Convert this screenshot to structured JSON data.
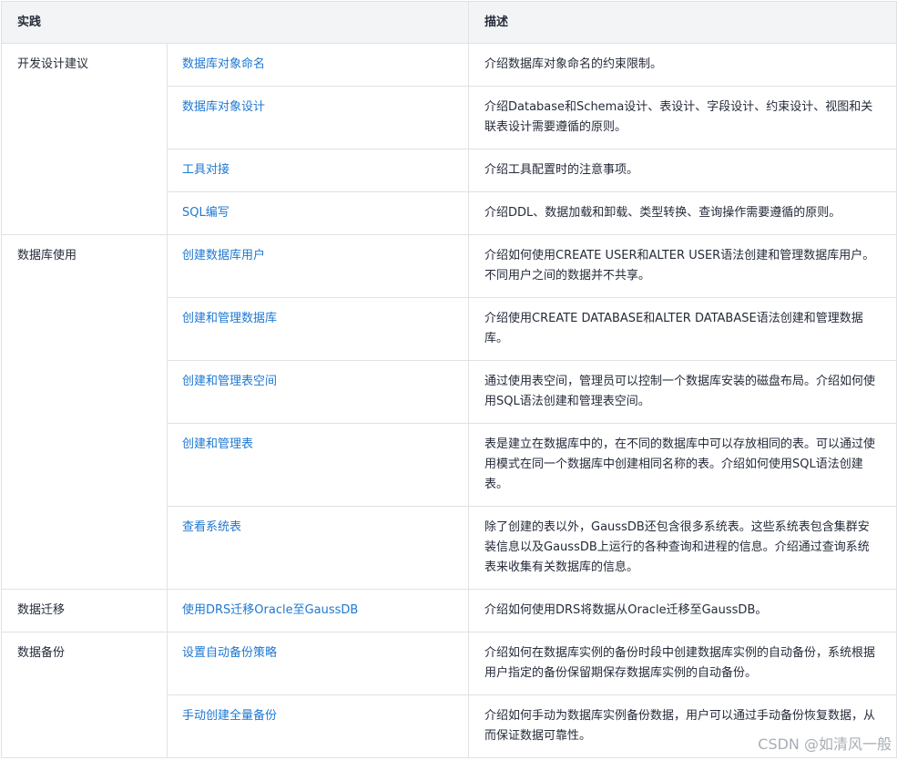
{
  "header": {
    "practice": "实践",
    "description": "描述"
  },
  "groups": [
    {
      "category": "开发设计建议",
      "rows": [
        {
          "link": "数据库对象命名",
          "desc": "介绍数据库对象命名的约束限制。"
        },
        {
          "link": "数据库对象设计",
          "desc": "介绍Database和Schema设计、表设计、字段设计、约束设计、视图和关联表设计需要遵循的原则。"
        },
        {
          "link": "工具对接",
          "desc": "介绍工具配置时的注意事项。"
        },
        {
          "link": "SQL编写",
          "desc": "介绍DDL、数据加载和卸载、类型转换、查询操作需要遵循的原则。"
        }
      ]
    },
    {
      "category": "数据库使用",
      "rows": [
        {
          "link": "创建数据库用户",
          "desc": "介绍如何使用CREATE USER和ALTER USER语法创建和管理数据库用户。不同用户之间的数据并不共享。"
        },
        {
          "link": "创建和管理数据库",
          "desc": "介绍使用CREATE DATABASE和ALTER DATABASE语法创建和管理数据库。"
        },
        {
          "link": "创建和管理表空间",
          "desc": "通过使用表空间，管理员可以控制一个数据库安装的磁盘布局。介绍如何使用SQL语法创建和管理表空间。"
        },
        {
          "link": "创建和管理表",
          "desc": "表是建立在数据库中的，在不同的数据库中可以存放相同的表。可以通过使用模式在同一个数据库中创建相同名称的表。介绍如何使用SQL语法创建表。"
        },
        {
          "link": "查看系统表",
          "desc": "除了创建的表以外，GaussDB还包含很多系统表。这些系统表包含集群安装信息以及GaussDB上运行的各种查询和进程的信息。介绍通过查询系统表来收集有关数据库的信息。"
        }
      ]
    },
    {
      "category": "数据迁移",
      "rows": [
        {
          "link": "使用DRS迁移Oracle至GaussDB",
          "desc": "介绍如何使用DRS将数据从Oracle迁移至GaussDB。"
        }
      ]
    },
    {
      "category": "数据备份",
      "rows": [
        {
          "link": "设置自动备份策略",
          "desc": "介绍如何在数据库实例的备份时段中创建数据库实例的自动备份，系统根据用户指定的备份保留期保存数据库实例的自动备份。"
        },
        {
          "link": "手动创建全量备份",
          "desc": "介绍如何手动为数据库实例备份数据，用户可以通过手动备份恢复数据，从而保证数据可靠性。"
        }
      ]
    }
  ],
  "watermark": "CSDN @如清风一般"
}
